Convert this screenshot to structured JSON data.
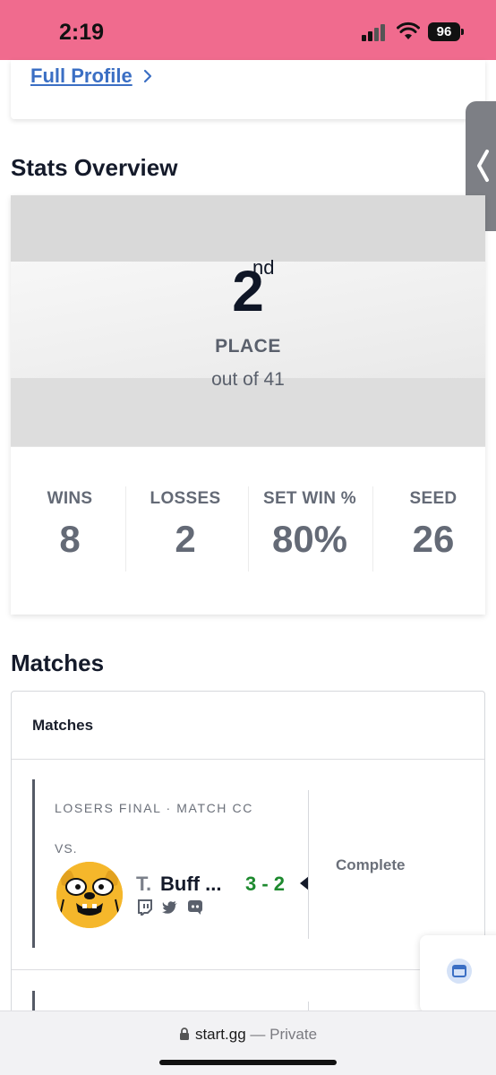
{
  "status_bar": {
    "time": "2:19",
    "battery": "96",
    "background": "#f06b8e"
  },
  "profile": {
    "full_profile_link": "Full Profile"
  },
  "stats_overview": {
    "title": "Stats Overview",
    "place_number": "2",
    "place_suffix": "nd",
    "place_label": "PLACE",
    "out_of": "out of 41",
    "stats": [
      {
        "label": "WINS",
        "value": "8"
      },
      {
        "label": "LOSSES",
        "value": "2"
      },
      {
        "label": "SET WIN %",
        "value": "80%"
      },
      {
        "label": "SEED",
        "value": "26"
      }
    ]
  },
  "matches": {
    "title": "Matches",
    "card_header": "Matches",
    "items": [
      {
        "round": "LOSERS FINAL · MATCH CC",
        "vs": "VS.",
        "opponent_prefix": "T.",
        "opponent_name": "Buff ...",
        "score": "3 - 2",
        "status": "Complete",
        "socials": [
          "twitch-icon",
          "twitter-icon",
          "discord-icon"
        ]
      }
    ]
  },
  "browser": {
    "domain": "start.gg",
    "mode": "— Private"
  },
  "colors": {
    "link": "#3b6fc4",
    "score_win": "#1e8a2f",
    "text_dark": "#141a2a",
    "text_muted": "#646a76"
  }
}
